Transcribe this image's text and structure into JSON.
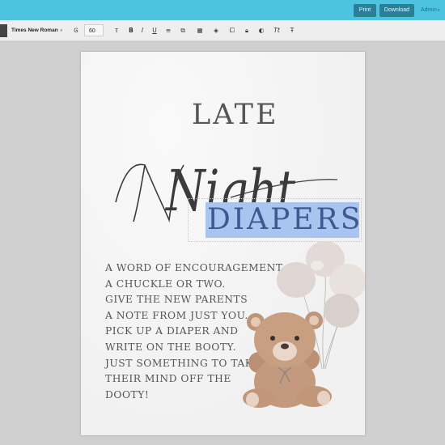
{
  "header": {
    "print_label": "Print",
    "download_label": "Download",
    "admin_label": "Admin"
  },
  "toolbar": {
    "font_family": "Times New Roman",
    "font_size": "60",
    "icons": [
      "format-paint-icon",
      "text-height-icon",
      "bold-icon",
      "italic-icon",
      "underline-icon",
      "align-icon",
      "resize-icon",
      "layers-icon",
      "duplicate-icon",
      "lock-icon",
      "opacity-icon",
      "text-transform-icon",
      "letter-spacing-icon"
    ]
  },
  "document": {
    "title_line1": "LATE",
    "title_script": "Night",
    "title_line2": "DIAPERS",
    "selected_text": "DIAPERS",
    "poem_lines": [
      "A WORD OF ENCOURAGEMENT...",
      "A CHUCKLE OR TWO.",
      "GIVE THE NEW PARENTS",
      "A NOTE FROM JUST YOU.",
      "PICK UP A DIAPER AND",
      "WRITE ON THE BOOTY.",
      "JUST SOMETHING TO TAKE",
      "THEIR MIND OFF THE",
      "DOOTY!"
    ],
    "illustration": "teddy-bear-with-balloons"
  },
  "colors": {
    "header_bg": "#4ec3e0",
    "button_bg": "#2a7f96",
    "selection": "#a9c4ef",
    "selected_text": "#3b5a8f",
    "body_text": "#555555"
  }
}
